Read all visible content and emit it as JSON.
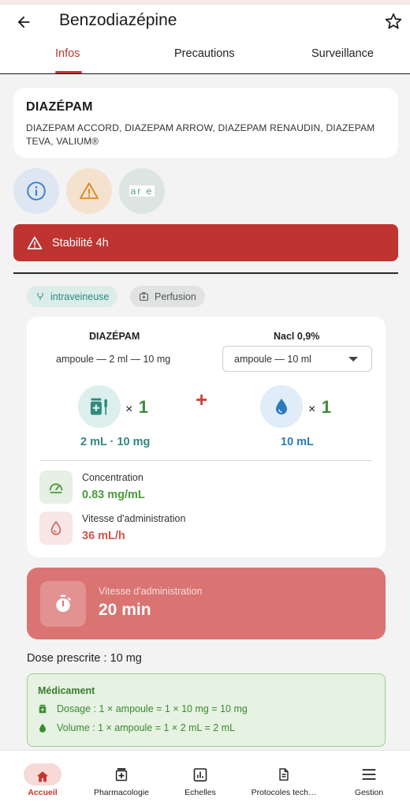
{
  "header": {
    "title": "Benzodiazépine"
  },
  "tabs": [
    {
      "label": "Infos",
      "active": true
    },
    {
      "label": "Precautions",
      "active": false
    },
    {
      "label": "Surveillance",
      "active": false
    }
  ],
  "drug": {
    "name": "DIAZÉPAM",
    "brands": "DIAZEPAM ACCORD, DIAZEPAM ARROW, DIAZEPAM RENAUDIN, DIAZEPAM TEVA, VALIUM®"
  },
  "quick_actions": {
    "care_text": "ar e"
  },
  "alert": {
    "text": "Stabilité 4h"
  },
  "chips": {
    "route": "intraveineuse",
    "mode": "Perfusion"
  },
  "preparation": {
    "drug_header": "DIAZÉPAM",
    "drug_form": "ampoule — 2 ml — 10 mg",
    "diluent_header": "Nacl 0,9%",
    "diluent_select": "ampoule — 10 ml",
    "drug_times": "× ",
    "drug_count": "1",
    "diluent_times": "× ",
    "diluent_count": "1",
    "plus": "+",
    "drug_qty": "2 mL · 10 mg",
    "diluent_qty": "10 mL",
    "concentration_label": "Concentration",
    "concentration_value": "0.83 mg/mL",
    "speed_label": "Vitesse d'administration",
    "speed_value": "36 mL/h"
  },
  "rate_card": {
    "label": "Vitesse d'administration",
    "value": "20 min"
  },
  "dose": {
    "text": "Dose prescrite : 10 mg"
  },
  "medication": {
    "title": "Médicament",
    "dosage": "Dosage : 1 × ampoule = 1 × 10 mg = 10 mg",
    "volume": "Volume : 1 × ampoule = 1 × 2 mL = 2 mL"
  },
  "nav": [
    {
      "label": "Accueil",
      "icon": "home-icon",
      "active": true
    },
    {
      "label": "Pharmacologie",
      "icon": "medicine-box-icon",
      "active": false
    },
    {
      "label": "Echelles",
      "icon": "chart-icon",
      "active": false
    },
    {
      "label": "Protocoles tech…",
      "icon": "document-icon",
      "active": false
    },
    {
      "label": "Gestion",
      "icon": "menu-icon",
      "active": false
    }
  ],
  "colors": {
    "accent": "#c5352f",
    "alert_bg": "#bf3430",
    "rate_card_bg": "#d97472",
    "teal": "#2f8a80",
    "blue": "#2b79c1",
    "green": "#3e8a3a"
  }
}
